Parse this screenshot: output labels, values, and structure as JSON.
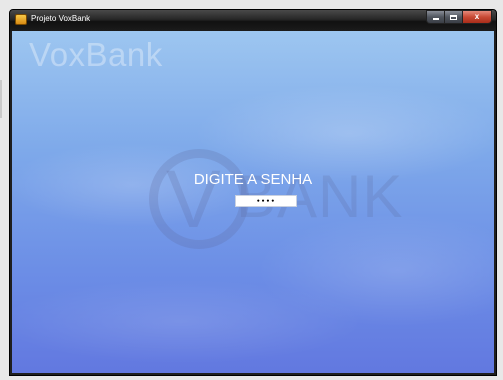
{
  "window": {
    "title": "Projeto VoxBank",
    "minimize_label": "",
    "maximize_label": "",
    "close_label": "x"
  },
  "main": {
    "brand_title": "VoxBank",
    "prompt_label": "DIGITE A SENHA",
    "password_value": "••••"
  },
  "watermark": {
    "letter": "V",
    "word": "BANK"
  },
  "colors": {
    "background_top": "#9dc6f0",
    "background_bottom": "#6278e0",
    "close_button": "#c94a35"
  }
}
